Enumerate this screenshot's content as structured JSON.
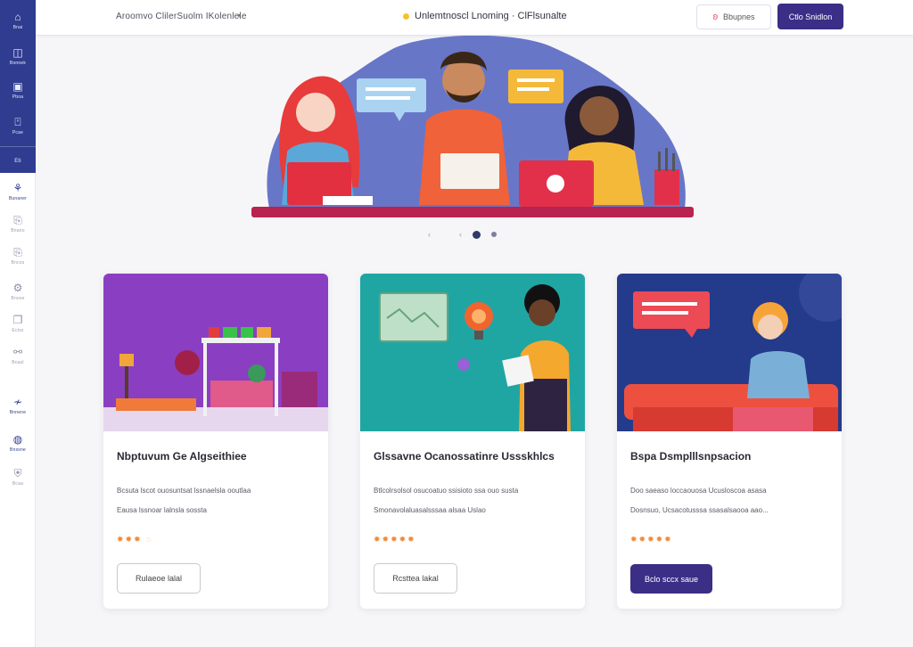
{
  "sidebar": {
    "top_items": [
      {
        "icon": "home-icon",
        "glyph": "⌂",
        "label": "Bnai"
      },
      {
        "icon": "book-icon",
        "glyph": "◫",
        "label": "Bonnek"
      },
      {
        "icon": "calendar-icon",
        "glyph": "▣",
        "label": "Pboa"
      },
      {
        "icon": "lock-icon",
        "glyph": "⍞",
        "label": "Pcae"
      },
      {
        "icon": "grid-icon",
        "glyph": "",
        "label": "Eti"
      }
    ],
    "bottom_items": [
      {
        "icon": "users-icon",
        "glyph": "⚘",
        "label": "Bunaner"
      },
      {
        "icon": "file-icon",
        "glyph": "⎘",
        "label": "Bnano"
      },
      {
        "icon": "file-alt-icon",
        "glyph": "⎘",
        "label": "Bncos"
      },
      {
        "icon": "gear-icon",
        "glyph": "⚙",
        "label": "Bnose"
      },
      {
        "icon": "box-icon",
        "glyph": "❐",
        "label": "Ectss"
      },
      {
        "icon": "link-icon",
        "glyph": "⚯",
        "label": "Bnasl"
      },
      {
        "icon": "chart-icon",
        "glyph": "≁",
        "label": "Bnnene"
      },
      {
        "icon": "globe-icon",
        "glyph": "◍",
        "label": "Bnssne"
      },
      {
        "icon": "shield-icon",
        "glyph": "⛨",
        "label": "Bcaa"
      }
    ]
  },
  "header": {
    "brand": "Aroomvo ClilerSuolm IKolenlele",
    "caret": "▾",
    "center_title": "Unlemtnoscl Lnoming · ClFlsunalte",
    "ghost_button": "Bbupnes",
    "primary_button": "Ctlo Snidlon"
  },
  "carousel": {
    "prev": "‹",
    "prev2": "‹"
  },
  "cards": [
    {
      "title": "Nbptuvum Ge Algseithiee",
      "desc": [
        "Bcsuta lscot ouosuntsat lssnaelsla ooutlaa",
        "Eausa lssnoar lalnsla sossta"
      ],
      "rating": "✹✹✹ ◌",
      "button": "Rulaeoe lalal"
    },
    {
      "title": "Glssavne Ocanossatinre Ussskhlcs",
      "desc": [
        "Btlcolrsolsol osucoatuo ssisioto ssa ouo susta",
        "Smonavolaluasalsssaa alsaa Uslao"
      ],
      "rating": "✹✹✹✹✹",
      "button": "Rcsttea lakal"
    },
    {
      "title": "Bspa Dsmplllsnpsacion",
      "desc": [
        "Doo saeaso loccaouosa Ucusloscoa asasa",
        "Dosnsuo, Ucsacotusssa ssasalsaooa aao..."
      ],
      "rating": "✹✹✹✹✹",
      "button": "Bclo sccx saue"
    }
  ],
  "colors": {
    "sidebar": "#2f3c8f",
    "primary": "#3b2e86",
    "rating": "#f08b3a"
  }
}
